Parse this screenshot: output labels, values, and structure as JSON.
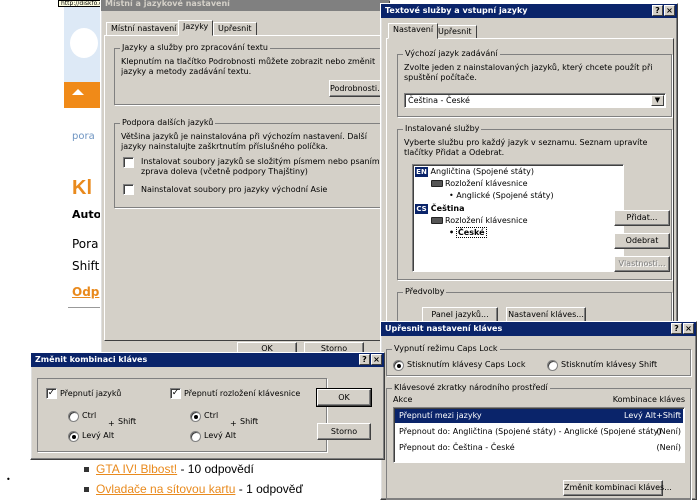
{
  "web": {
    "url_tooltip": "http://diskfo.cz",
    "pora1": "pora",
    "heading": "Kl",
    "auto": "Auto",
    "pora2": "Pora",
    "shift": "Shift",
    "odp": "Odp",
    "list": [
      {
        "link": "GTA IV! Blbost!",
        "suffix": " - 10 odpovědí"
      },
      {
        "link": "Ovladače na sítovou kartu",
        "suffix": " - 1 odpověď"
      }
    ]
  },
  "regional": {
    "title": "Místní a jazykové nastavení",
    "tabs": [
      "Místní nastavení",
      "Jazyky",
      "Upřesnit"
    ],
    "group1": {
      "label": "Jazyky a služby pro zpracování textu",
      "text": "Klepnutím na tlačítko Podrobnosti můžete zobrazit nebo změnit jazyky a metody zadávání textu.",
      "button": "Podrobnosti..."
    },
    "group2": {
      "label": "Podpora dalších jazyků",
      "text": "Většina jazyků je nainstalována při výchozím nastavení. Další jazyky nainstalujte zaškrtnutím příslušného políčka.",
      "check1": "Instalovat soubory jazyků se složitým písmem nebo psaním zprava doleva (včetně podpory Thajštiny)",
      "check2": "Nainstalovat soubory pro jazyky východní Asie"
    },
    "ok": "OK",
    "cancel": "Storno"
  },
  "textservices": {
    "title": "Textové služby a vstupní jazyky",
    "tabs": [
      "Nastavení",
      "Upřesnit"
    ],
    "default_group": {
      "label": "Výchozí jazyk zadávání",
      "text": "Zvolte jeden z nainstalovaných jazyků, který chcete použít při spuštění počítače.",
      "selected": "Čeština - České"
    },
    "installed_group": {
      "label": "Instalované služby",
      "text": "Vyberte službu pro každý jazyk v seznamu. Seznam upravíte tlačítky Přidat a Odebrat.",
      "tree": [
        {
          "tag": "EN",
          "name": "Angličtina (Spojené státy)",
          "layout_label": "Rozložení klávesnice",
          "layout": "Anglické (Spojené státy)"
        },
        {
          "tag": "CS",
          "name": "Čeština",
          "layout_label": "Rozložení klávesnice",
          "layout": "České"
        }
      ],
      "add": "Přidat...",
      "remove": "Odebrat",
      "properties": "Vlastnosti..."
    },
    "prefs_group": {
      "label": "Předvolby",
      "language_bar": "Panel jazyků...",
      "key_settings": "Nastavení kláves..."
    }
  },
  "advanced_keys": {
    "title": "Upřesnit nastavení kláves",
    "caps_group": {
      "label": "Vypnutí režimu Caps Lock",
      "option1": "Stisknutím klávesy Caps Lock",
      "option2": "Stisknutím klávesy Shift"
    },
    "hotkeys_group": {
      "label": "Klávesové zkratky národního prostředí",
      "col_action": "Akce",
      "col_combo": "Kombinace kláves",
      "rows": [
        {
          "action": "Přepnutí mezi jazyky",
          "combo": "Levý Alt+Shift"
        },
        {
          "action": "Přepnout do: Angličtina (Spojené státy) - Anglické (Spojené státy)",
          "combo": "(Není)"
        },
        {
          "action": "Přepnout do: Čeština - České",
          "combo": "(Není)"
        }
      ]
    },
    "change_button": "Změnit kombinaci kláves..."
  },
  "change_combo": {
    "title": "Změnit kombinaci kláves",
    "switch_languages": "Přepnutí jazyků",
    "switch_layout": "Přepnutí rozložení klávesnice",
    "ctrl": "Ctrl",
    "left_alt": "Levý Alt",
    "plus": "+",
    "shift": "Shift",
    "ok": "OK",
    "cancel": "Storno"
  },
  "title_buttons": {
    "help": "?",
    "close": "×"
  }
}
